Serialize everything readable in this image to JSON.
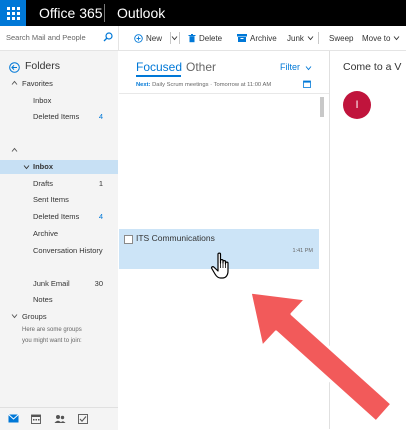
{
  "topbar": {
    "brand": "Office 365",
    "app": "Outlook"
  },
  "search": {
    "placeholder": "Search Mail and People"
  },
  "toolbar": {
    "new_label": "New",
    "delete_label": "Delete",
    "archive_label": "Archive",
    "junk_label": "Junk",
    "sweep_label": "Sweep",
    "moveto_label": "Move to"
  },
  "sidebar": {
    "folders_title": "Folders",
    "favorites_label": "Favorites",
    "favorites": [
      {
        "label": "Inbox",
        "count": ""
      },
      {
        "label": "Deleted Items",
        "count": "4"
      }
    ],
    "folders": [
      {
        "label": "Inbox",
        "count": ""
      },
      {
        "label": "Drafts",
        "count": "1"
      },
      {
        "label": "Sent Items",
        "count": ""
      },
      {
        "label": "Deleted Items",
        "count": "4"
      },
      {
        "label": "Archive",
        "count": ""
      },
      {
        "label": "Conversation History",
        "count": ""
      },
      {
        "label": "Junk Email",
        "count": "30"
      },
      {
        "label": "Notes",
        "count": ""
      }
    ],
    "groups_label": "Groups",
    "groups_note_1": "Here are some groups",
    "groups_note_2": "you might want to join:"
  },
  "message_list": {
    "tab_focused": "Focused",
    "tab_other": "Other",
    "filter_label": "Filter",
    "next_prefix": "Next:",
    "next_event": "Daily Scrum meetings",
    "next_time": "Tomorrow at 11:00 AM",
    "messages": [
      {
        "sender": "ITS Communications",
        "time": "1:41 PM"
      }
    ]
  },
  "reading_pane": {
    "subject": "Come to a V",
    "avatar_initial": "I"
  },
  "colors": {
    "accent": "#0078d7",
    "topbar": "#000000",
    "nav_bg": "#f4f4f4",
    "selected_bg": "#c7e0f4",
    "arrow": "#f25a5a",
    "avatar": "#c0143c"
  }
}
